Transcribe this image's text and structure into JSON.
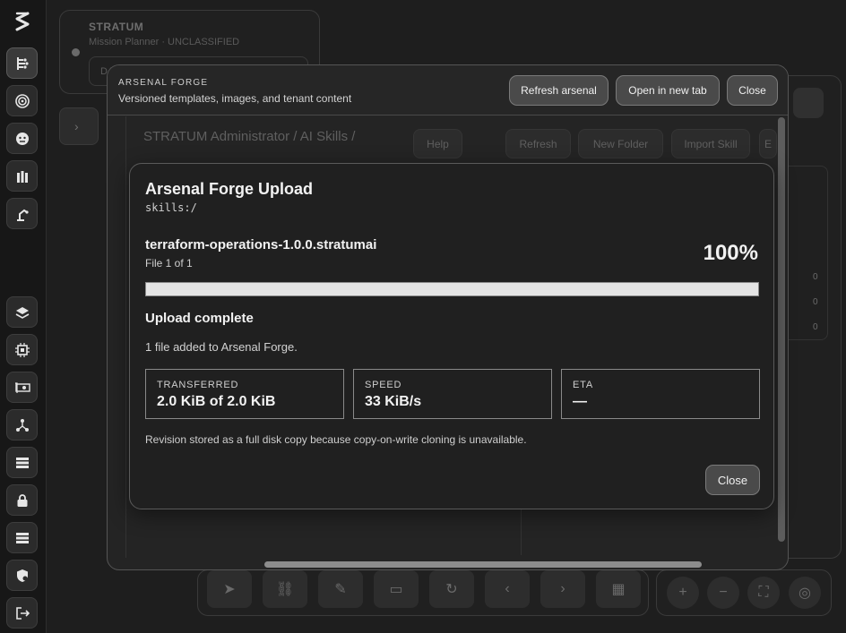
{
  "rail": {
    "items": [
      "logo-icon",
      "flow-icon",
      "target-icon",
      "robot-icon",
      "ammo-icon",
      "robot-arm-icon",
      "layers-icon",
      "chip-icon",
      "gpu-icon",
      "network-icon",
      "server-icon",
      "lock-icon",
      "storage-icon",
      "shield-icon",
      "logout-icon"
    ]
  },
  "mission": {
    "title": "STRATUM",
    "subtitle": "Mission Planner · UNCLASSIFIED",
    "inner_text": "DA"
  },
  "right_panel": {
    "values": [
      "0",
      "0",
      "0"
    ]
  },
  "arsenal": {
    "eyebrow": "ARSENAL FORGE",
    "subtitle": "Versioned templates, images, and tenant content",
    "refresh_label": "Refresh arsenal",
    "open_tab_label": "Open in new tab",
    "close_label": "Close",
    "breadcrumb": "STRATUM Administrator / AI Skills /",
    "help_label": "Help",
    "refresh_label_dim": "Refresh",
    "new_folder_label": "New Folder",
    "import_skill_label": "Import Skill",
    "extra_label": "E"
  },
  "upload": {
    "title": "Arsenal Forge Upload",
    "path": "skills:/",
    "filename": "terraform-operations-1.0.0.stratumai",
    "file_count": "File 1 of 1",
    "percent_text": "100%",
    "progress": 1.0,
    "status": "Upload complete",
    "message": "1 file added to Arsenal Forge.",
    "stats": [
      {
        "label": "TRANSFERRED",
        "value": "2.0 KiB of 2.0 KiB"
      },
      {
        "label": "SPEED",
        "value": "33 KiB/s"
      },
      {
        "label": "ETA",
        "value": "—"
      }
    ],
    "note": "Revision stored as a full disk copy because copy-on-write cloning is unavailable.",
    "close_label": "Close"
  }
}
